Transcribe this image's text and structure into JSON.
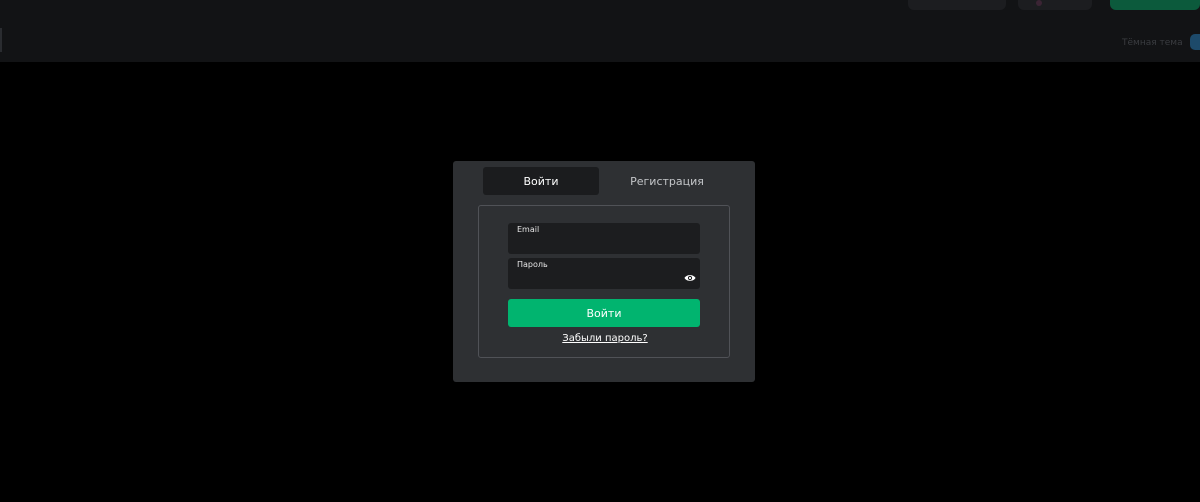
{
  "header": {
    "small_text": "Тёмная тема"
  },
  "modal": {
    "tabs": [
      {
        "label": "Войти",
        "active": true
      },
      {
        "label": "Регистрация",
        "active": false
      }
    ],
    "email": {
      "label": "Email",
      "value": ""
    },
    "password": {
      "label": "Пароль",
      "value": "",
      "toggle_icon": "eye-icon"
    },
    "submit_label": "Войти",
    "forgot_label": "Забыли пароль?"
  },
  "colors": {
    "accent": "#01b46f",
    "modal_bg": "#2e3033",
    "input_bg": "#1c1d1f",
    "page_bg": "#000000"
  }
}
